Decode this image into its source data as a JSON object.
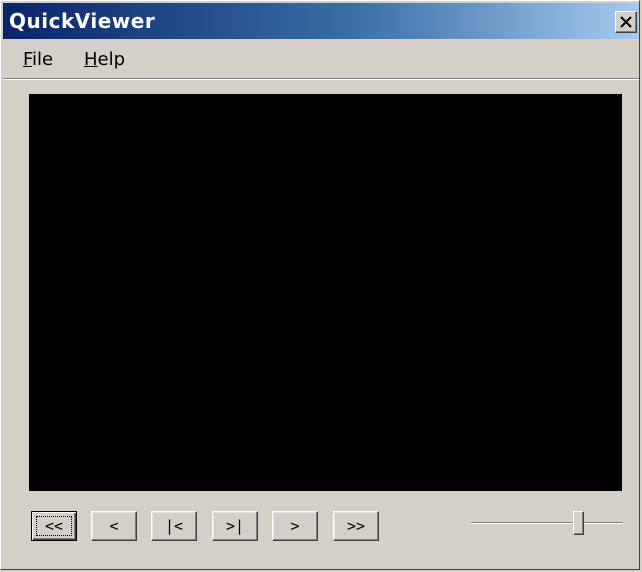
{
  "window": {
    "title": "QuickViewer",
    "close_icon": "close-x-icon"
  },
  "menu": {
    "file": {
      "label": "File",
      "accel": "F",
      "rest": "ile"
    },
    "help": {
      "label": "Help",
      "accel": "H",
      "rest": "elp"
    }
  },
  "controls": {
    "first": "<<",
    "prev": "<",
    "start": "|<",
    "end": ">|",
    "next": ">",
    "last": ">>"
  },
  "slider": {
    "value_fraction": 0.72
  },
  "colors": {
    "title_gradient_start": "#0a246a",
    "title_gradient_end": "#a6caf0",
    "face": "#d4d0c8",
    "video_background": "#000000"
  }
}
